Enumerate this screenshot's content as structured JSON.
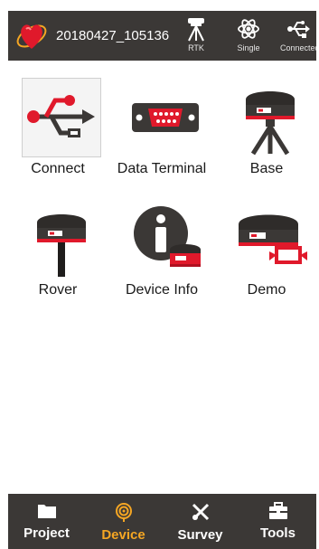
{
  "header": {
    "project_name": "20180427_105136",
    "status": [
      {
        "id": "rtk",
        "label": "RTK",
        "icon": "survey-tripod-icon"
      },
      {
        "id": "single",
        "label": "Single",
        "icon": "atom-icon"
      },
      {
        "id": "connect",
        "label": "Connected",
        "icon": "usb-icon"
      }
    ]
  },
  "tiles": [
    {
      "label": "Connect",
      "icon": "usb-connect-icon",
      "selected": true
    },
    {
      "label": "Data Terminal",
      "icon": "serial-port-icon"
    },
    {
      "label": "Base",
      "icon": "base-receiver-icon"
    },
    {
      "label": "Rover",
      "icon": "rover-receiver-icon"
    },
    {
      "label": "Device Info",
      "icon": "device-info-icon"
    },
    {
      "label": "Demo",
      "icon": "demo-receiver-icon"
    }
  ],
  "nav": {
    "items": [
      {
        "label": "Project",
        "icon": "folder-icon"
      },
      {
        "label": "Device",
        "icon": "device-target-icon",
        "active": true
      },
      {
        "label": "Survey",
        "icon": "survey-tools-icon"
      },
      {
        "label": "Tools",
        "icon": "toolbox-icon"
      }
    ]
  },
  "colors": {
    "bar": "#3b3836",
    "accent": "#f5a623",
    "brand_red": "#e0192b"
  }
}
